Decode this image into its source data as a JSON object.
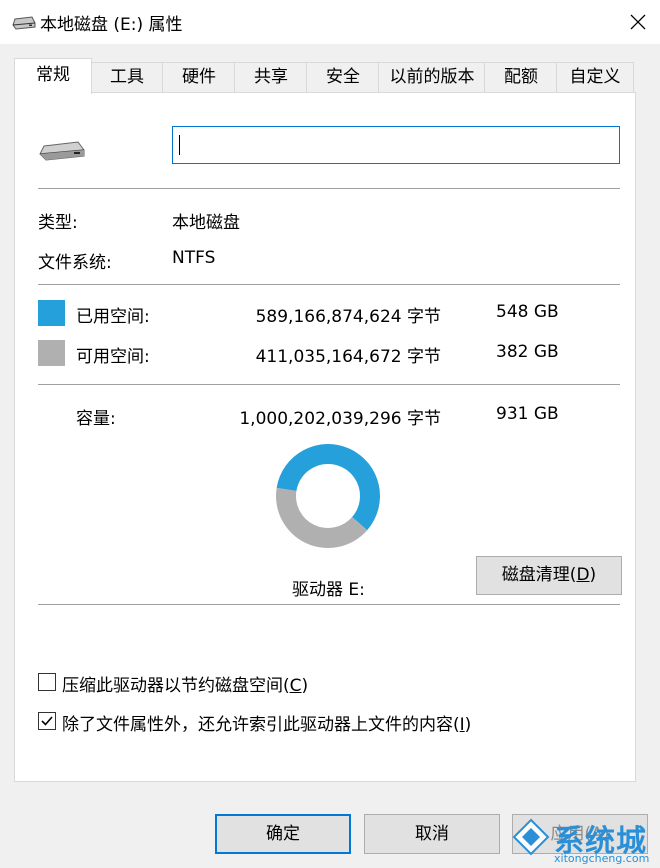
{
  "window": {
    "title": "本地磁盘 (E:) 属性",
    "icon": "drive-icon",
    "close_icon": "close-icon"
  },
  "tabs": [
    {
      "label": "常规",
      "active": true
    },
    {
      "label": "工具"
    },
    {
      "label": "硬件"
    },
    {
      "label": "共享"
    },
    {
      "label": "安全"
    },
    {
      "label": "以前的版本"
    },
    {
      "label": "配额"
    },
    {
      "label": "自定义"
    }
  ],
  "general": {
    "name_value": "",
    "type_label": "类型:",
    "type_value": "本地磁盘",
    "fs_label": "文件系统:",
    "fs_value": "NTFS",
    "used": {
      "label": "已用空间:",
      "bytes": "589,166,874,624 字节",
      "size": "548 GB",
      "color": "#26a0da"
    },
    "free": {
      "label": "可用空间:",
      "bytes": "411,035,164,672 字节",
      "size": "382 GB",
      "color": "#b0b0b0"
    },
    "capacity": {
      "label": "容量:",
      "bytes": "1,000,202,039,296 字节",
      "size": "931 GB"
    },
    "drive_label": "驱动器 E:",
    "cleanup_button": {
      "text": "磁盘清理(",
      "key": "D",
      "end": ")"
    },
    "compress": {
      "text": "压缩此驱动器以节约磁盘空间(",
      "key": "C",
      "end": ")",
      "checked": false
    },
    "index": {
      "text": "除了文件属性外，还允许索引此驱动器上文件的内容(",
      "key": "I",
      "end": ")",
      "checked": true
    }
  },
  "buttons": {
    "ok": "确定",
    "cancel": "取消",
    "apply": "应用(A)"
  },
  "watermark": {
    "text": "系统城",
    "url": "xitongcheng.com"
  },
  "chart_data": {
    "type": "pie",
    "categories": [
      "已用空间",
      "可用空间"
    ],
    "values": [
      548,
      382
    ],
    "colors": [
      "#26a0da",
      "#b0b0b0"
    ]
  }
}
